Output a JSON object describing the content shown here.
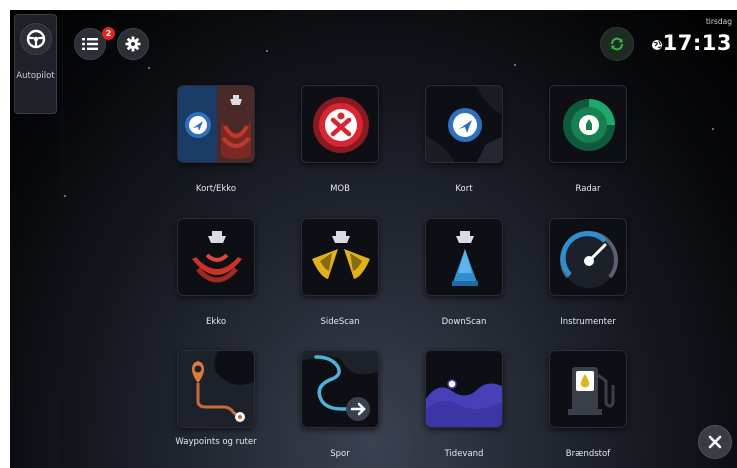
{
  "sidebar": {
    "autopilot_label": "Autopilot"
  },
  "topbar": {
    "notification_count": "2",
    "day": "tirsdag",
    "time": "17:13"
  },
  "tiles": [
    {
      "label": "Kort/Ekko"
    },
    {
      "label": "MOB"
    },
    {
      "label": "Kort"
    },
    {
      "label": "Radar"
    },
    {
      "label": "Ekko"
    },
    {
      "label": "SideScan"
    },
    {
      "label": "DownScan"
    },
    {
      "label": "Instrumenter"
    },
    {
      "label": "Waypoints og ruter"
    },
    {
      "label": "Spor"
    },
    {
      "label": "Tidevand"
    },
    {
      "label": "Brændstof"
    }
  ],
  "colors": {
    "accent_red": "#e0241f",
    "sync_green": "#36b54a",
    "sonar_red": "#c9332a",
    "sonar_yellow": "#e0b21c",
    "sonar_blue": "#2f8fd0",
    "tide_purple": "#4840b8"
  }
}
